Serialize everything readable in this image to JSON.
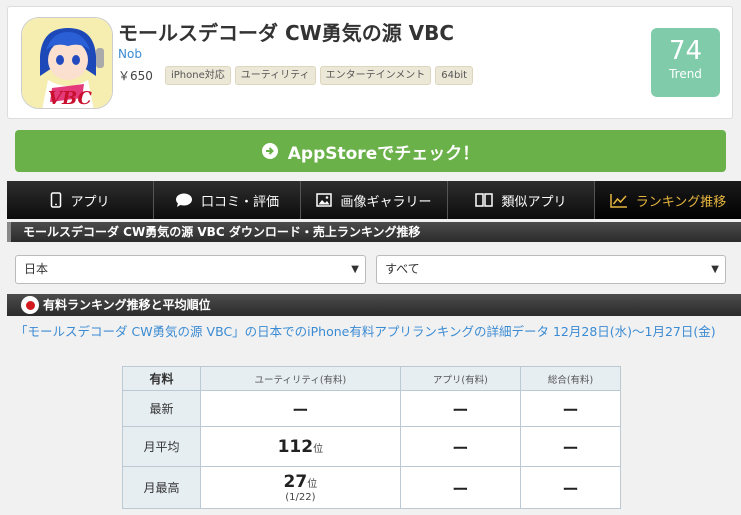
{
  "app": {
    "title": "モールスデコーダ CW勇気の源 VBC",
    "developer": "Nob",
    "price": "￥650",
    "tags": [
      "iPhone対応",
      "ユーティリティ",
      "エンターテインメント",
      "64bit"
    ],
    "icon_text": "VBC",
    "trend_value": "74",
    "trend_label": "Trend"
  },
  "appstore_button": "AppStoreでチェック！",
  "nav": [
    {
      "label": "アプリ",
      "icon": "phone-icon"
    },
    {
      "label": "口コミ・評価",
      "icon": "speech-bubble-icon"
    },
    {
      "label": "画像ギャラリー",
      "icon": "image-icon"
    },
    {
      "label": "類似アプリ",
      "icon": "book-icon"
    },
    {
      "label": "ランキング推移",
      "icon": "chart-line-icon"
    }
  ],
  "section_title": "モールスデコーダ CW勇気の源 VBC ダウンロード・売上ランキング推移",
  "selects": {
    "country": "日本",
    "category": "すべて"
  },
  "ranking_header": "有料ランキング推移と平均順位",
  "description": "「モールスデコーダ CW勇気の源 VBC」の日本でのiPhone有料アプリランキングの詳細データ 12月28日(水)～1月27日(金)",
  "table": {
    "headers": [
      "有料",
      "ユーティリティ(有料)",
      "アプリ(有料)",
      "総合(有料)"
    ],
    "rows": [
      {
        "label": "最新",
        "cells": [
          "ー",
          "ー",
          "ー"
        ]
      },
      {
        "label": "月平均",
        "rank": "112",
        "unit": "位",
        "cells": [
          "ー",
          "ー"
        ]
      },
      {
        "label": "月最高",
        "rank": "27",
        "unit": "位",
        "date": "(1/22)",
        "cells": [
          "ー",
          "ー"
        ]
      }
    ]
  },
  "colors": {
    "trend_bg": "#7fcbaa",
    "appstore_btn": "#6ab14a",
    "link": "#3b8bd3",
    "nav_active": "#e6b540"
  }
}
